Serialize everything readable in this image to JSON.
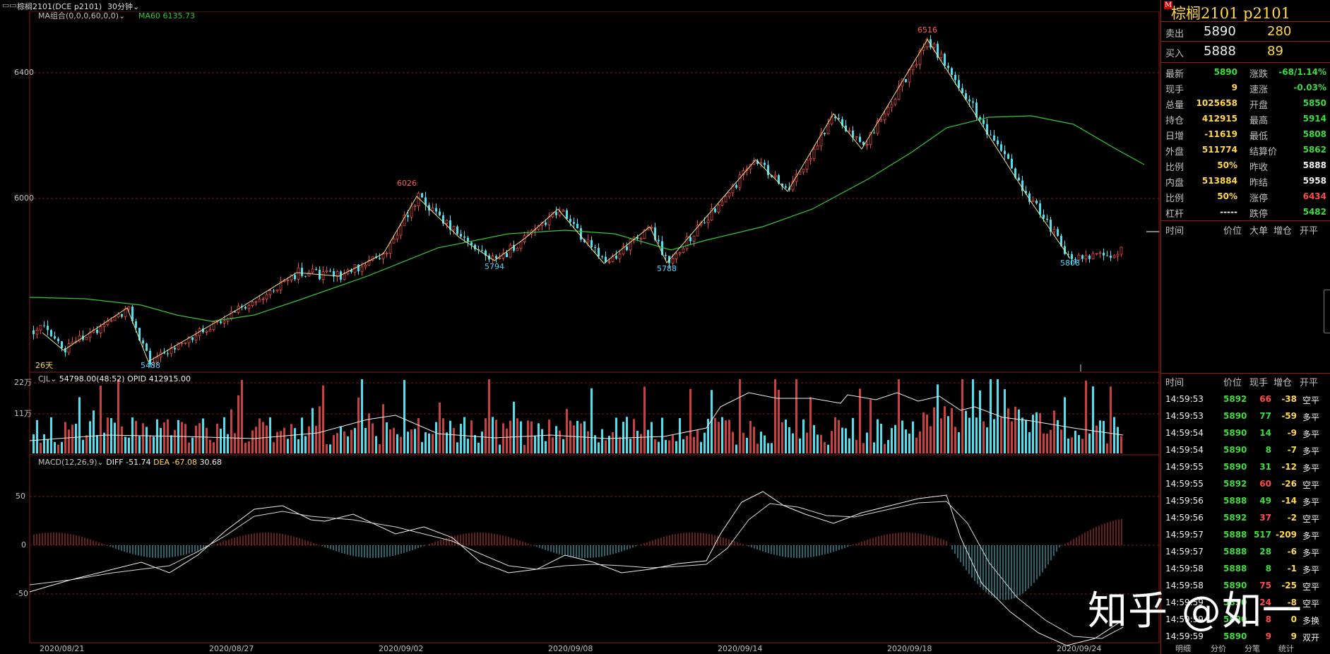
{
  "header": {
    "symbol_label": "棕榈2101(DCE p2101)",
    "period_label": "30分钟",
    "icon": "window-icon"
  },
  "main_chart": {
    "indicator_label": "MA组合(0,0,0,60,0,0)",
    "ma_label": "MA60",
    "ma_value": "6135.73",
    "y_ticks": [
      "6400",
      "6000"
    ],
    "peak_labels": [
      "6516",
      "6026",
      "5794",
      "5788",
      "5808",
      "5488"
    ],
    "corner_label": "26天",
    "colors": {
      "up": "#e84848",
      "down": "#4fe0f0",
      "ma": "#35c735",
      "zigzag": "#f0e68c",
      "grid": "#7a1a1a"
    }
  },
  "volume_chart": {
    "indicator_label": "CJL",
    "value_text": "54798.00(48:52)",
    "opid_text": "OPID 412915.00",
    "y_ticks": [
      "22万",
      "11万"
    ]
  },
  "macd_chart": {
    "indicator_label": "MACD(12,26,9)",
    "diff_text": "DIFF -51.74",
    "dea_text": "DEA -67.08",
    "macd_value": "30.68",
    "y_ticks": [
      "50",
      "0",
      "-50"
    ]
  },
  "x_axis": {
    "dates": [
      "2020/08/21",
      "2020/08/27",
      "2020/09/02",
      "2020/09/08",
      "2020/09/14",
      "2020/09/18",
      "2020/09/24"
    ]
  },
  "quote_panel": {
    "title": "棕榈2101  p2101",
    "title_marker": "M",
    "ask_label": "卖出",
    "ask_price": "5890",
    "ask_volume": "280",
    "bid_label": "买入",
    "bid_price": "5888",
    "bid_volume": "89",
    "stats": [
      {
        "l1": "最新",
        "v1": "5890",
        "c1": "green",
        "l2": "涨跌",
        "v2": "-68/1.14%",
        "c2": "green"
      },
      {
        "l1": "现手",
        "v1": "9",
        "c1": "yellow",
        "l2": "速涨",
        "v2": "-0.03%",
        "c2": "green"
      },
      {
        "l1": "总量",
        "v1": "1025658",
        "c1": "yellow",
        "l2": "开盘",
        "v2": "5850",
        "c2": "green"
      },
      {
        "l1": "持仓",
        "v1": "412915",
        "c1": "yellow",
        "l2": "最高",
        "v2": "5914",
        "c2": "green"
      },
      {
        "l1": "日增",
        "v1": "-11619",
        "c1": "yellow",
        "l2": "最低",
        "v2": "5808",
        "c2": "green"
      },
      {
        "l1": "外盘",
        "v1": "511774",
        "c1": "yellow",
        "l2": "结算价",
        "v2": "5862",
        "c2": "green"
      },
      {
        "l1": "比例",
        "v1": "50%",
        "c1": "yellow",
        "l2": "昨收",
        "v2": "5888",
        "c2": "white"
      },
      {
        "l1": "内盘",
        "v1": "513884",
        "c1": "yellow",
        "l2": "昨结",
        "v2": "5958",
        "c2": "white"
      },
      {
        "l1": "比例",
        "v1": "50%",
        "c1": "yellow",
        "l2": "涨停",
        "v2": "6434",
        "c2": "red"
      },
      {
        "l1": "杠杆",
        "v1": "-----",
        "c1": "white",
        "l2": "跌停",
        "v2": "5482",
        "c2": "green"
      }
    ],
    "big_order_header": [
      "时间",
      "价位",
      "大单",
      "增仓",
      "开平"
    ],
    "tick_header": [
      "时间",
      "价位",
      "现手",
      "增仓",
      "开平"
    ],
    "ticks": [
      {
        "time": "14:59:53",
        "price": "5892",
        "vol": "66",
        "vc": "red",
        "oi": "-38",
        "type": "空平"
      },
      {
        "time": "14:59:53",
        "price": "5890",
        "vol": "77",
        "vc": "green",
        "oi": "-59",
        "type": "多平"
      },
      {
        "time": "14:59:54",
        "price": "5890",
        "vol": "14",
        "vc": "green",
        "oi": "-9",
        "type": "多平"
      },
      {
        "time": "14:59:54",
        "price": "5890",
        "vol": "8",
        "vc": "green",
        "oi": "-7",
        "type": "多平"
      },
      {
        "time": "14:59:55",
        "price": "5890",
        "vol": "31",
        "vc": "green",
        "oi": "-12",
        "type": "多平"
      },
      {
        "time": "14:59:55",
        "price": "5892",
        "vol": "60",
        "vc": "red",
        "oi": "-26",
        "type": "空平"
      },
      {
        "time": "14:59:56",
        "price": "5888",
        "vol": "49",
        "vc": "green",
        "oi": "-14",
        "type": "多平"
      },
      {
        "time": "14:59:56",
        "price": "5892",
        "vol": "37",
        "vc": "red",
        "oi": "-2",
        "type": "空平"
      },
      {
        "time": "14:59:57",
        "price": "5888",
        "vol": "517",
        "vc": "green",
        "oi": "-209",
        "type": "多平"
      },
      {
        "time": "14:59:57",
        "price": "5888",
        "vol": "28",
        "vc": "green",
        "oi": "-6",
        "type": "多平"
      },
      {
        "time": "14:59:58",
        "price": "5888",
        "vol": "8",
        "vc": "green",
        "oi": "-1",
        "type": "多平"
      },
      {
        "time": "14:59:58",
        "price": "5890",
        "vol": "75",
        "vc": "red",
        "oi": "-25",
        "type": "空平"
      },
      {
        "time": "14:59:59",
        "price": "5890",
        "vol": "24",
        "vc": "red",
        "oi": "-8",
        "type": "空平"
      },
      {
        "time": "14:59:59",
        "price": "5890",
        "vol": "8",
        "vc": "red",
        "oi": "0",
        "type": "多换"
      },
      {
        "time": "14:59:59",
        "price": "5890",
        "vol": "9",
        "vc": "red",
        "oi": "9",
        "type": "双开"
      }
    ],
    "bottom_tabs": [
      "明细",
      "分价",
      "分笔",
      "统计"
    ]
  },
  "watermark": "知乎 @如一",
  "chart_data": [
    {
      "type": "line",
      "title": "棕榈2101 30分钟",
      "series": [
        {
          "name": "MA60",
          "x": [
            0,
            10,
            20,
            30,
            40,
            50,
            60,
            70,
            80,
            90,
            100
          ],
          "y": [
            5720,
            5640,
            5690,
            5830,
            5850,
            5835,
            5900,
            5995,
            6100,
            6280,
            6140
          ]
        }
      ],
      "pivots": [
        {
          "label": "5488",
          "value": 5488
        },
        {
          "label": "6026",
          "value": 6026
        },
        {
          "label": "5794",
          "value": 5794
        },
        {
          "label": "5788",
          "value": 5788
        },
        {
          "label": "6516",
          "value": 6516
        },
        {
          "label": "5808",
          "value": 5808
        }
      ],
      "ylim": [
        5450,
        6560
      ]
    },
    {
      "type": "bar",
      "title": "CJL",
      "ylim": [
        0,
        220000
      ]
    },
    {
      "type": "line",
      "title": "MACD(12,26,9)",
      "series": [
        {
          "name": "DIFF",
          "value": -51.74
        },
        {
          "name": "DEA",
          "value": -67.08
        },
        {
          "name": "MACD",
          "value": 30.68
        }
      ],
      "ylim": [
        -100,
        70
      ]
    }
  ]
}
